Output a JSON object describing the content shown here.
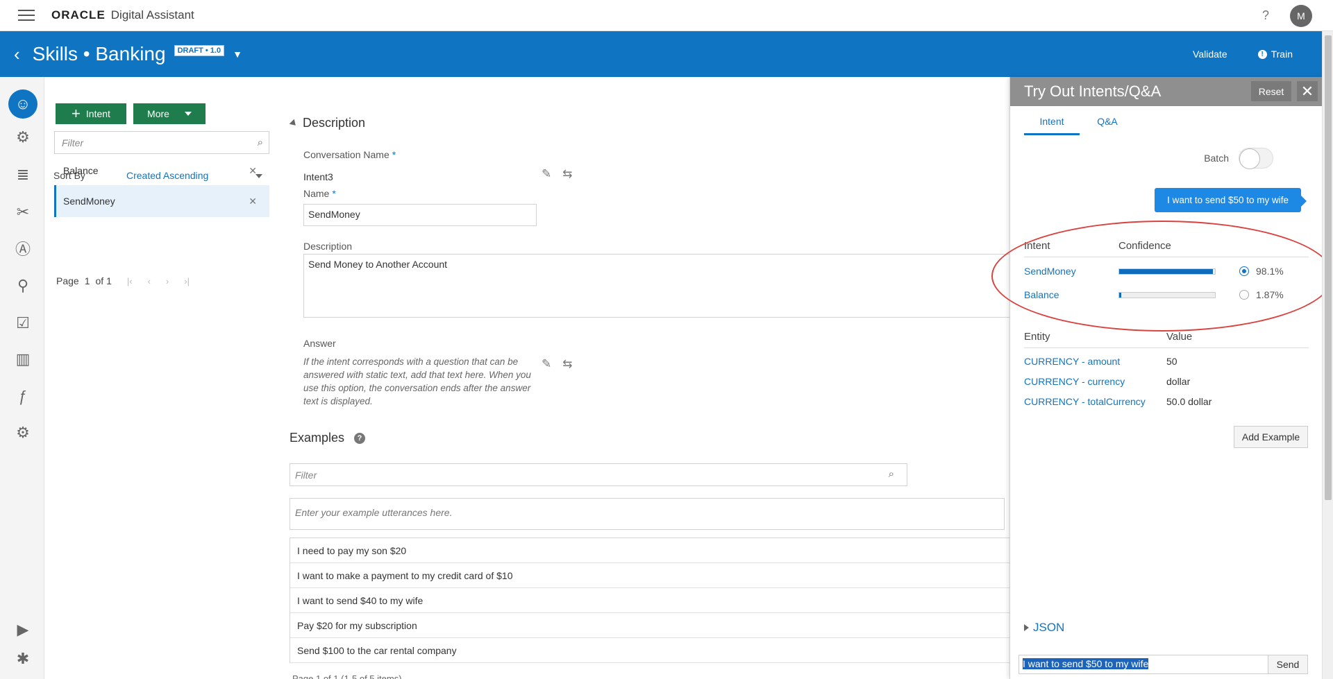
{
  "header": {
    "brand": "ORACLE",
    "product": "Digital Assistant",
    "help": "?",
    "avatar": "M"
  },
  "titlebar": {
    "title": "Skills • Banking",
    "badge": "DRAFT • 1.0",
    "validate": "Validate",
    "train": "Train"
  },
  "rail": {
    "icons": [
      "intents-icon",
      "entities-icon",
      "flows-icon",
      "components-icon",
      "resource-bundles-icon",
      "quality-icon",
      "insights-icon",
      "analytics-icon",
      "functions-icon",
      "settings-icon",
      "play-icon",
      "debug-icon"
    ]
  },
  "list": {
    "intent_btn": "Intent",
    "more_btn": "More",
    "filter_placeholder": "Filter",
    "sort_label": "Sort By",
    "sort_value": "Created Ascending",
    "items": [
      "Balance",
      "SendMoney"
    ],
    "page_label": "Page",
    "page_num": "1",
    "page_of": "of 1"
  },
  "main": {
    "description_head": "Description",
    "conv_name_label": "Conversation Name",
    "conv_name_value": "Intent3",
    "name_label": "Name",
    "name_value": "SendMoney",
    "desc_label": "Description",
    "desc_value": "Send Money to Another Account",
    "answer_label": "Answer",
    "answer_hint": "If the intent corresponds with a question that can be answered with static text, add that text here. When you use this option, the conversation ends after the answer text is displayed.",
    "examples_head": "Examples",
    "ex_filter_placeholder": "Filter",
    "ex_input_placeholder": "Enter your example utterances here.",
    "examples": [
      "I need to pay my son $20",
      "I want to make a payment to my credit card of $10",
      "I want to send $40 to my wife",
      "Pay $20 for my subscription",
      "Send $100 to the car rental company"
    ],
    "ex_pager": "Page  1  of 1  (1-5 of 5 items)"
  },
  "tryout": {
    "title": "Try Out Intents/Q&A",
    "reset": "Reset",
    "tabs": [
      "Intent",
      "Q&A"
    ],
    "batch": "Batch",
    "utterance": "I want to send $50 to my wife",
    "intent_col": "Intent",
    "confidence_col": "Confidence",
    "results": [
      {
        "intent": "SendMoney",
        "confidence": 98.1,
        "pct": "98.1%",
        "selected": true
      },
      {
        "intent": "Balance",
        "confidence": 1.87,
        "pct": "1.87%",
        "selected": false
      }
    ],
    "entity_col": "Entity",
    "value_col": "Value",
    "entities": [
      {
        "entity": "CURRENCY - amount",
        "value": "50"
      },
      {
        "entity": "CURRENCY - currency",
        "value": "dollar"
      },
      {
        "entity": "CURRENCY - totalCurrency",
        "value": "50.0 dollar"
      }
    ],
    "add_example": "Add Example",
    "json": "JSON",
    "input_value": "I want to send $50 to my wife",
    "send": "Send"
  },
  "colors": {
    "brand_blue": "#0f75c3",
    "green": "#1f7d4d",
    "highlight_red": "#d9423e"
  }
}
